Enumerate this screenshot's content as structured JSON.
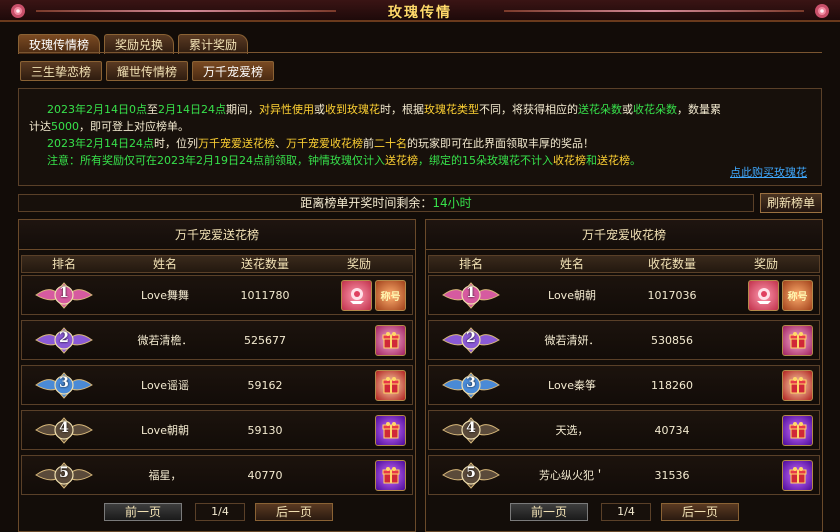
{
  "window": {
    "title": "玫瑰传情"
  },
  "tabs_main": [
    {
      "label": "玫瑰传情榜",
      "active": true
    },
    {
      "label": "奖励兑换",
      "active": false
    },
    {
      "label": "累计奖励",
      "active": false
    }
  ],
  "tabs_sub": [
    {
      "label": "三生挚恋榜",
      "active": false
    },
    {
      "label": "耀世传情榜",
      "active": false
    },
    {
      "label": "万千宠爱榜",
      "active": true
    }
  ],
  "notice": {
    "line1": [
      {
        "t": "2023年2月14日0点",
        "c": "green"
      },
      {
        "t": "至",
        "c": "white"
      },
      {
        "t": "2月14日24点",
        "c": "green"
      },
      {
        "t": "期间，",
        "c": "white"
      },
      {
        "t": "对异性使用",
        "c": "yellow"
      },
      {
        "t": "或",
        "c": "white"
      },
      {
        "t": "收到玫瑰花",
        "c": "yellow"
      },
      {
        "t": "时，根据",
        "c": "white"
      },
      {
        "t": "玫瑰花类型",
        "c": "yellow"
      },
      {
        "t": "不同，将获得相应的",
        "c": "white"
      },
      {
        "t": "送花朵数",
        "c": "green"
      },
      {
        "t": "或",
        "c": "white"
      },
      {
        "t": "收花朵数",
        "c": "green"
      },
      {
        "t": "，数量累",
        "c": "white"
      }
    ],
    "line2": [
      {
        "t": "计达",
        "c": "white"
      },
      {
        "t": "5000",
        "c": "green"
      },
      {
        "t": "，即可登上对应榜单。",
        "c": "white"
      }
    ],
    "line3": [
      {
        "t": "2023年2月14日24点",
        "c": "green"
      },
      {
        "t": "时，位列",
        "c": "white"
      },
      {
        "t": "万千宠爱送花榜",
        "c": "yellow"
      },
      {
        "t": "、",
        "c": "white"
      },
      {
        "t": "万千宠爱收花榜",
        "c": "yellow"
      },
      {
        "t": "前",
        "c": "white"
      },
      {
        "t": "二十名",
        "c": "yellow"
      },
      {
        "t": "的玩家即可在此界面领取丰厚的奖品！",
        "c": "white"
      }
    ],
    "line4": [
      {
        "t": "注意：所有奖励仅可在",
        "c": "green"
      },
      {
        "t": "2023年2月19日24点",
        "c": "green"
      },
      {
        "t": "前领取，钟情玫瑰仅计入",
        "c": "green"
      },
      {
        "t": "送花榜",
        "c": "yellow"
      },
      {
        "t": "，绑定的15朵玫瑰花不计入",
        "c": "green"
      },
      {
        "t": "收花榜",
        "c": "yellow"
      },
      {
        "t": "和",
        "c": "green"
      },
      {
        "t": "送花榜",
        "c": "yellow"
      },
      {
        "t": "。",
        "c": "green"
      }
    ],
    "buy_link": "点此购买玫瑰花"
  },
  "countdown": {
    "label": "距离榜单开奖时间剩余：",
    "value": "14小时"
  },
  "refresh_label": "刷新榜单",
  "columns": {
    "rank": "排名",
    "name": "姓名",
    "reward": "奖励"
  },
  "panels": [
    {
      "title": "万千宠爱送花榜",
      "num_header": "送花数量",
      "rows": [
        {
          "rank": "1",
          "name": "Love舞舞",
          "value": "1011780",
          "rewards": [
            "rose-icon",
            "title-icon"
          ],
          "reward_text": "称号"
        },
        {
          "rank": "2",
          "name": "微若清檐．",
          "value": "525677",
          "rewards": [
            "gift-pink-icon"
          ]
        },
        {
          "rank": "3",
          "name": "Love谣谣",
          "value": "59162",
          "rewards": [
            "gift-red-icon"
          ]
        },
        {
          "rank": "4",
          "name": "Love朝朝",
          "value": "59130",
          "rewards": [
            "gift-purple-icon"
          ]
        },
        {
          "rank": "5",
          "name": "福星，",
          "value": "40770",
          "rewards": [
            "gift-purple-icon"
          ]
        }
      ],
      "pager": {
        "prev": "前一页",
        "page": "1/4",
        "next": "后一页"
      }
    },
    {
      "title": "万千宠爱收花榜",
      "num_header": "收花数量",
      "rows": [
        {
          "rank": "1",
          "name": "Love朝朝",
          "value": "1017036",
          "rewards": [
            "rose-icon",
            "title-icon"
          ],
          "reward_text": "称号"
        },
        {
          "rank": "2",
          "name": "微若清妍．",
          "value": "530856",
          "rewards": [
            "gift-pink-icon"
          ]
        },
        {
          "rank": "3",
          "name": "Love秦筝",
          "value": "118260",
          "rewards": [
            "gift-red-icon"
          ]
        },
        {
          "rank": "4",
          "name": "天选，",
          "value": "40734",
          "rewards": [
            "gift-purple-icon"
          ]
        },
        {
          "rank": "5",
          "name": "芳心纵火犯＇",
          "value": "31536",
          "rewards": [
            "gift-purple-icon"
          ]
        }
      ],
      "pager": {
        "prev": "前一页",
        "page": "1/4",
        "next": "后一页"
      }
    }
  ],
  "colors": {
    "gold": "#ffd86a",
    "green": "#37e24b",
    "yellow": "#ffd233",
    "link": "#3fa9ff",
    "rank1": "#d65aa0",
    "rank2": "#8a5ad6",
    "rank3": "#4a8ad6",
    "rank_other": "#5a4a3a"
  }
}
